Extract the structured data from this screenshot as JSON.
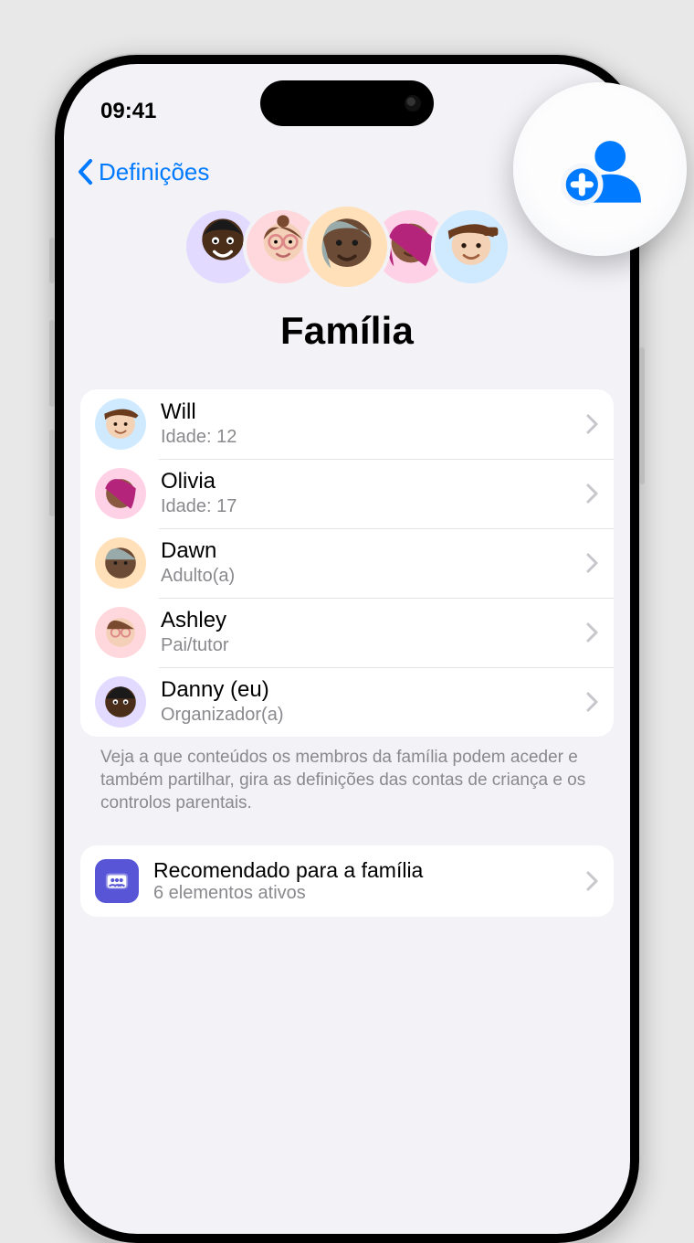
{
  "status": {
    "time": "09:41"
  },
  "nav": {
    "back_label": "Definições"
  },
  "hero": {
    "title": "Família"
  },
  "members": [
    {
      "name": "Will",
      "sub": "Idade: 12",
      "avatar": "av-blue"
    },
    {
      "name": "Olivia",
      "sub": "Idade: 17",
      "avatar": "av-magenta"
    },
    {
      "name": "Dawn",
      "sub": "Adulto(a)",
      "avatar": "av-orange"
    },
    {
      "name": "Ashley",
      "sub": "Pai/tutor",
      "avatar": "av-pink"
    },
    {
      "name": "Danny (eu)",
      "sub": "Organizador(a)",
      "avatar": "av-lilac"
    }
  ],
  "footnote": "Veja a que conteúdos os membros da família podem aceder e também partilhar, gira as definições das contas de criança e os controlos parentais.",
  "recommended": {
    "title": "Recomendado para a família",
    "sub": "6 elementos ativos"
  },
  "icons": {
    "add_person": "add-person-icon",
    "back": "chevron-left-icon",
    "row_chevron": "chevron-right-icon"
  },
  "colors": {
    "accent": "#007aff",
    "background": "#f2f2f7",
    "secondary_text": "#8a8a8e",
    "recommended_icon": "#5856d6"
  }
}
